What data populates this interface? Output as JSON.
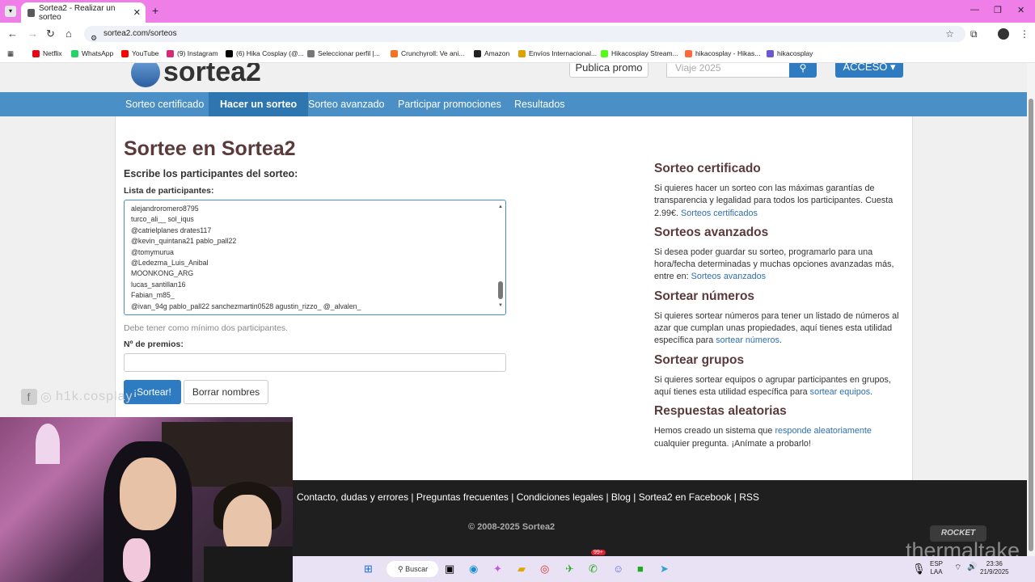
{
  "browser": {
    "tab_title": "Sortea2 - Realizar un sorteo",
    "url": "sortea2.com/sorteos",
    "bookmarks": [
      {
        "label": "Netflix",
        "color": "#e50914"
      },
      {
        "label": "WhatsApp",
        "color": "#25d366"
      },
      {
        "label": "YouTube",
        "color": "#ff0000"
      },
      {
        "label": "(9) Instagram",
        "color": "#d62976"
      },
      {
        "label": "(6) Hika Cosplay (@...",
        "color": "#000000"
      },
      {
        "label": "Seleccionar perfil |...",
        "color": "#777777"
      },
      {
        "label": "Crunchyroll: Ve ani...",
        "color": "#f47521"
      },
      {
        "label": "Amazon",
        "color": "#222222"
      },
      {
        "label": "Envíos Internacional...",
        "color": "#e0a000"
      },
      {
        "label": "Hikacosplay Stream...",
        "color": "#53fc18"
      },
      {
        "label": "hikacosplay - Hikas...",
        "color": "#ff6a3d"
      },
      {
        "label": "hikacosplay",
        "color": "#6a5acd"
      }
    ]
  },
  "site": {
    "logo": "sortea2",
    "publica_promo": "Publica promo",
    "search_placeholder": "Viaje 2025",
    "acceso": "ACCESO ▾",
    "nav": [
      "Sorteo certificado",
      "Hacer un sorteo",
      "Sorteo avanzado",
      "Participar promociones",
      "Resultados"
    ]
  },
  "main": {
    "title": "Sortee en Sortea2",
    "subtitle": "Escribe los participantes del sorteo:",
    "list_label": "Lista de participantes:",
    "participants": [
      "alejandroromero8795",
      "turco_ali__ sol_iqus",
      "@catrielplanes drates117",
      "@kevin_quintana21 pablo_pall22",
      "@tomymurua",
      "@Ledezma_Luis_Anibal",
      "MOONKONG_ARG",
      "lucas_santillan16",
      "Fabian_m85_",
      "@ivan_94g pablo_pall22 sanchezmartin0528 agustin_rizzo_ @_alvalen_"
    ],
    "hint": "Debe tener como mínimo dos participantes.",
    "prizes_label": "Nº de premios:",
    "prizes_value": "",
    "sortear_button": "¡Sortear!",
    "borrar_button": "Borrar nombres"
  },
  "sidebar": {
    "sections": [
      {
        "heading": "Sorteo certificado",
        "text": "Si quieres hacer un sorteo con las máximas garantías de transparencia y legalidad para todos los participantes. Cuesta 2.99€. ",
        "link": "Sorteos certificados",
        "after": ""
      },
      {
        "heading": "Sorteos avanzados",
        "text": "Si desea poder guardar su sorteo, programarlo para una hora/fecha determinadas y muchas opciones avanzadas más, entre en: ",
        "link": "Sorteos avanzados",
        "after": ""
      },
      {
        "heading": "Sortear números",
        "text": "Si quieres sortear números para tener un listado de números al azar que cumplan unas propiedades, aquí tienes esta utilidad específica para ",
        "link": "sortear números",
        "after": "."
      },
      {
        "heading": "Sortear grupos",
        "text": "Si quieres sortear equipos o agrupar participantes en grupos, aquí tienes esta utilidad específica para ",
        "link": "sortear equipos",
        "after": "."
      },
      {
        "heading": "Respuestas aleatorias",
        "text": "Hemos creado un sistema que ",
        "link": "responde aleatoriamente",
        "after": " cualquier pregunta. ¡Anímate a probarlo!"
      }
    ]
  },
  "footer": {
    "links": "Contacto, dudas y errores | Preguntas frecuentes | Condiciones legales | Blog | Sortea2 en Facebook | RSS",
    "copyright": "© 2008-2025 Sortea2"
  },
  "overlay": {
    "handle": "h1k.cosplay",
    "brand": "thermaltake",
    "rocket": "ROCKET"
  },
  "taskbar": {
    "search": "Buscar",
    "badge": "99+",
    "lang1": "ESP",
    "lang2": "LAA",
    "time": "23:36",
    "date": "21/9/2025"
  }
}
